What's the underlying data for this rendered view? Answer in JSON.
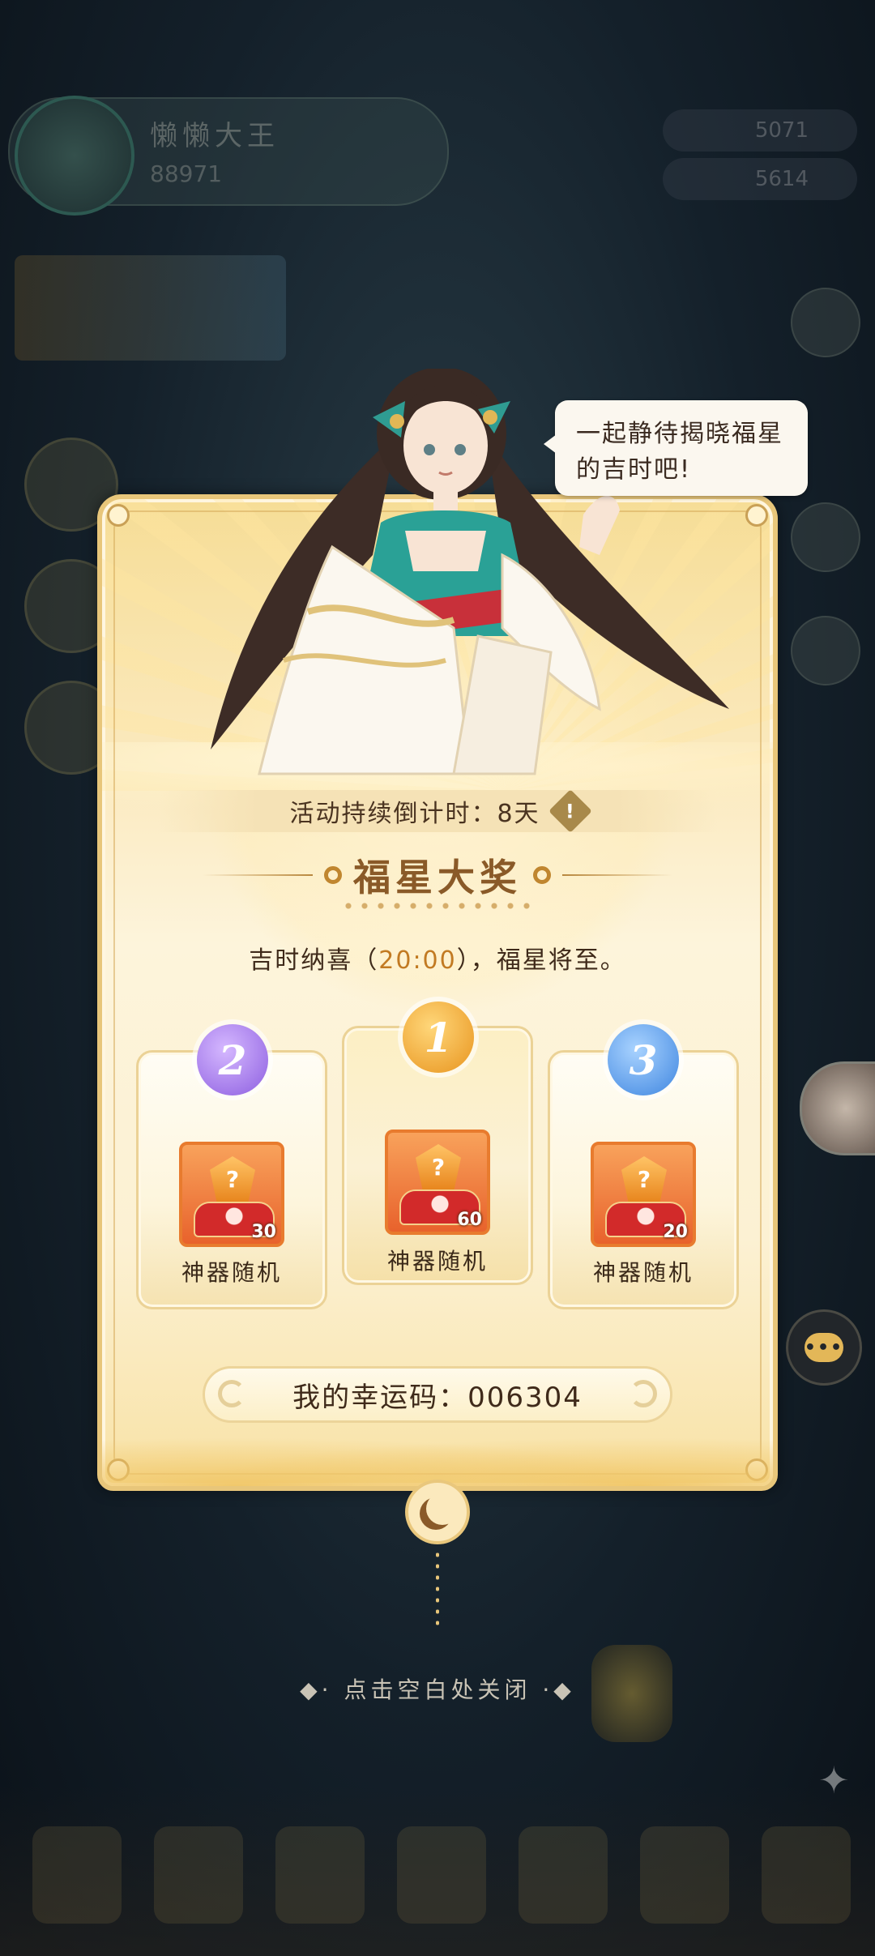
{
  "background": {
    "player_name": "懒懒大王",
    "player_power": "88971",
    "resource_1": "5071",
    "resource_2": "5614"
  },
  "speech_bubble": {
    "line1": "一起静待揭晓福星",
    "line2": "的吉时吧!"
  },
  "panel": {
    "countdown_label": "活动持续倒计时：8天",
    "title": "福星大奖",
    "subtitle_prefix": "吉时纳喜（",
    "subtitle_time": "20:00",
    "subtitle_suffix": "），福星将至。",
    "prizes": [
      {
        "rank": "2",
        "item_name": "神器随机",
        "count": "30"
      },
      {
        "rank": "1",
        "item_name": "神器随机",
        "count": "60"
      },
      {
        "rank": "3",
        "item_name": "神器随机",
        "count": "20"
      }
    ],
    "lucky_code_label": "我的幸运码：006304"
  },
  "close_hint": "点击空白处关闭",
  "colors": {
    "title": "#8a5a28",
    "time_highlight": "#c27a22",
    "rank1": "#e8941e",
    "rank2": "#8d5ee0",
    "rank3": "#3f86e0"
  },
  "icons": {
    "warning": "warning-icon",
    "chat": "chat-icon",
    "crescent": "crescent-moon-icon",
    "item": "random-artifact-chest-icon"
  }
}
